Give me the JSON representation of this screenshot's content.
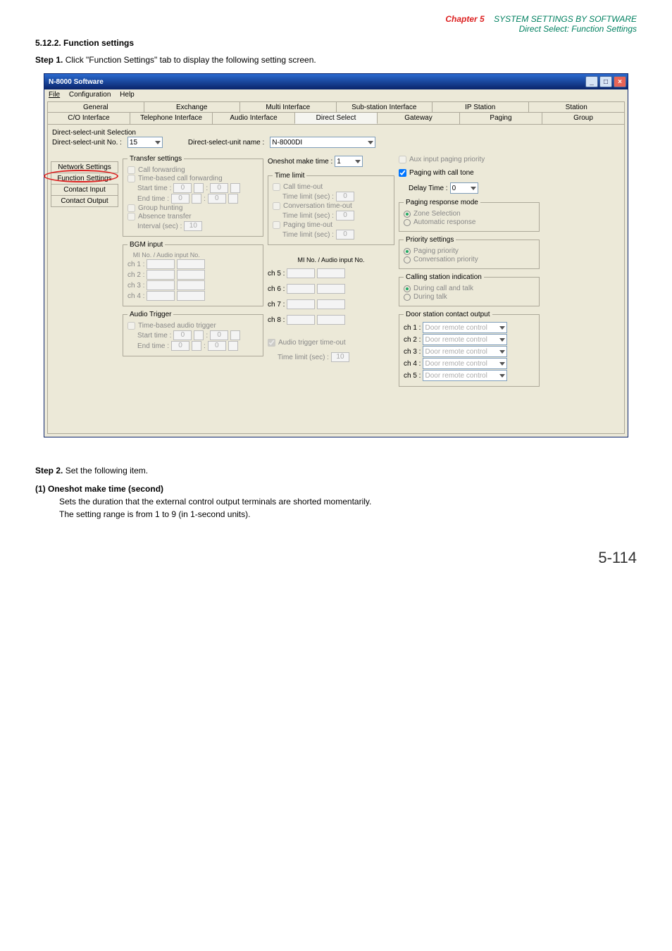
{
  "chapter": {
    "label": "Chapter 5",
    "title": "SYSTEM SETTINGS BY SOFTWARE",
    "subtitle": "Direct Select: Function Settings"
  },
  "section": {
    "number": "5.12.2.",
    "title": "Function settings"
  },
  "step1": {
    "prefix": "Step 1.",
    "body": "Click \"Function Settings\" tab to display the following setting screen."
  },
  "window": {
    "title": "N-8000 Software",
    "menu": {
      "file": "File",
      "config": "Configuration",
      "help": "Help"
    },
    "tabs_top": {
      "general": "General",
      "exchange": "Exchange",
      "multi": "Multi Interface",
      "sub": "Sub-station Interface",
      "ip": "IP Station",
      "station": "Station"
    },
    "tabs_bot": {
      "co": "C/O Interface",
      "tel": "Telephone Interface",
      "audio": "Audio Interface",
      "direct": "Direct Select",
      "gateway": "Gateway",
      "paging": "Paging",
      "group": "Group"
    },
    "selector": {
      "unit_no_label": "Direct-select-unit No. :",
      "unit_no_value": "15",
      "unit_name_label": "Direct-select-unit name :",
      "unit_name_value": "N-8000DI"
    },
    "side_tabs": {
      "net": "Network Settings",
      "func": "Function Settings",
      "cin": "Contact Input",
      "cout": "Contact Output"
    },
    "transfer": {
      "legend": "Transfer settings",
      "call_fwd": "Call forwarding",
      "time_based": "Time-based call forwarding",
      "start_time": "Start time :",
      "end_time": "End time   :",
      "group_hunting": "Group hunting",
      "absence": "Absence transfer",
      "interval": "Interval (sec) :",
      "interval_val": "10",
      "zero": "0"
    },
    "oneshot": {
      "label": "Oneshot make time :",
      "value": "1"
    },
    "timelimit": {
      "legend": "Time limit",
      "call": "Call time-out",
      "call_val": "0",
      "conv": "Conversation time-out",
      "conv_val": "0",
      "paging": "Paging time-out",
      "paging_val": "0",
      "tl": "Time limit (sec) :"
    },
    "aux": "Aux input paging priority",
    "ptone": {
      "label": "Paging with call tone",
      "delay": "Delay Time :",
      "delay_val": "0"
    },
    "response_mode": {
      "legend": "Paging response mode",
      "zone": "Zone Selection",
      "auto": "Automatic response"
    },
    "priority": {
      "legend": "Priority settings",
      "paging": "Paging priority",
      "conv": "Conversation priority"
    },
    "calling": {
      "legend": "Calling station indication",
      "dcall": "During call and talk",
      "dtalk": "During talk"
    },
    "bgm": {
      "legend": "BGM input",
      "mi_audio": "MI No. / Audio input No.",
      "ch1": "ch 1 :",
      "ch2": "ch 2 :",
      "ch3": "ch 3 :",
      "ch4": "ch 4 :",
      "ch5": "ch 5 :",
      "ch6": "ch 6 :",
      "ch7": "ch 7 :",
      "ch8": "ch 8 :"
    },
    "audio_trigger": {
      "legend": "Audio Trigger",
      "tb": "Time-based audio trigger",
      "at": "Audio trigger time-out",
      "start": "Start time :",
      "end": "End time   :",
      "tl": "Time limit (sec) :",
      "tl_val": "10",
      "zero": "0"
    },
    "door": {
      "legend": "Door station contact output",
      "ch1": "ch 1 :",
      "ch2": "ch 2 :",
      "ch3": "ch 3 :",
      "ch4": "ch 4 :",
      "ch5": "ch 5 :",
      "opt": "Door remote control"
    }
  },
  "step2": {
    "prefix": "Step 2.",
    "body": "Set the following item."
  },
  "desc": {
    "head": "(1)  Oneshot make time (second)",
    "l1": "Sets the duration that the external control output terminals are shorted momentarily.",
    "l2": "The setting range is from 1 to 9 (in 1-second units)."
  },
  "page": "5-114"
}
